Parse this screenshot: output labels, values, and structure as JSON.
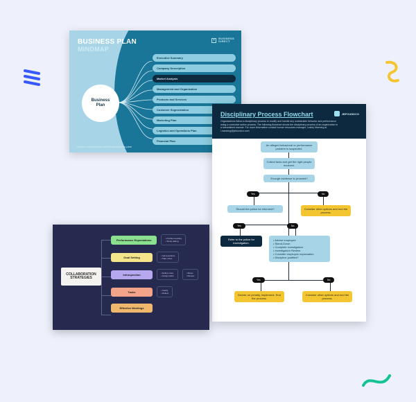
{
  "card1": {
    "title_l1": "BUSINESS PLAN",
    "title_l2": "MINDMAP",
    "logo_text": "BUSINESS\nDIRECT",
    "center": "Business\nPlan",
    "nodes": [
      "Executive Summary",
      "Company Description",
      "Market Analysis",
      "Management and Organization",
      "Products and Services",
      "Customer Segmentation",
      "Marketing Plan",
      "Logistics and Operations Plan",
      "Financial Plan"
    ],
    "dark_index": 2,
    "footer": "Source: www.shopify.com/blog/business-plan"
  },
  "card2": {
    "title": "Disciplinary Process Flowchart",
    "subtitle": "Organizations follow a disciplinary process to modify and handle any undesirable behavior and performance using a corrective action process. The following flowchart shows the disciplinary process of an organization in a streamlined manner. For more information contact human resources manager, Lesley Manning at l.manning@jbfoundco.com",
    "brand": "JBFOUNDCO",
    "boxes": {
      "b1": "An alleged behavioral or performance problem is suspected.",
      "b2": "Collect facts and get the right people involved.",
      "b3": "Enough evidence to proceed?",
      "b4": "Should the police be informed?",
      "b5": "Consider other options and end the process.",
      "b6": "Refer to the police for investigation.",
      "b7_l1": "• Advise employee",
      "b7_l2": "• Stand-Down",
      "b7_l3": "• Complete investigation",
      "b7_l4": "• Investigation Review",
      "b7_l5": "• Consider employee explanation",
      "b7_l6": "• Discipline justified?",
      "b8": "Consider other options and end the process.",
      "b9": "Decide on penalty, implement. End the process."
    },
    "labels": {
      "yes": "Yes",
      "no": "No"
    }
  },
  "card3": {
    "root": "COLLABORATION STRATEGIES",
    "branches": [
      {
        "label": "Performance Expectations",
        "color": "b-green",
        "subs": [
          "• Problem-solving\n• Study asking"
        ]
      },
      {
        "label": "Goal Setting",
        "color": "b-yellow",
        "subs": [
          "• Ask questions\n• Take notes"
        ]
      },
      {
        "label": "Introspection",
        "color": "b-purple",
        "subs": [
          "• Define roles\n• Assign tasks",
          "• Share\n• Review"
        ]
      },
      {
        "label": "Tasks",
        "color": "b-pink",
        "subs": [
          "• Clarify\n• Reflect"
        ]
      },
      {
        "label": "Effective Meetings",
        "color": "b-orange",
        "subs": []
      }
    ]
  }
}
